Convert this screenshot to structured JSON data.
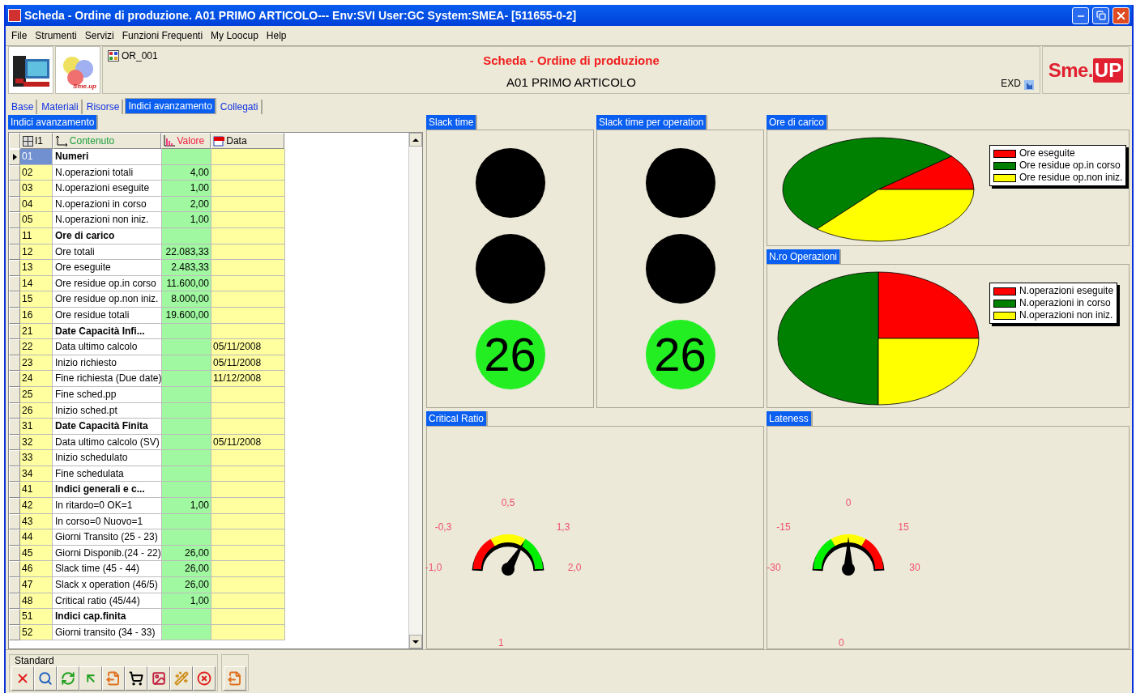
{
  "window": {
    "title": "Scheda - Ordine di produzione. A01 PRIMO ARTICOLO--- Env:SVI User:GC System:SMEA- [511655-0-2]"
  },
  "menu": [
    "File",
    "Strumenti",
    "Servizi",
    "Funzioni Frequenti",
    "My Loocup",
    "Help"
  ],
  "header": {
    "logo_text": "Sme.up",
    "code": "OR_001",
    "title": "Scheda - Ordine di produzione",
    "subtitle": "A01 PRIMO ARTICOLO",
    "exd": "EXD",
    "brand_left": "Sme.",
    "brand_right": "UP"
  },
  "tabs": [
    {
      "label": "Base",
      "selected": false
    },
    {
      "label": "Materiali",
      "selected": false
    },
    {
      "label": "Risorse",
      "selected": false
    },
    {
      "label": "Indici avanzamento",
      "selected": true
    },
    {
      "label": "Collegati",
      "selected": false
    }
  ],
  "table": {
    "title": "Indici avanzamento",
    "columns": [
      "I1",
      "Contenuto",
      "Valore",
      "Data"
    ],
    "rows": [
      {
        "id": "01",
        "content": "Numeri",
        "value": "",
        "date": "",
        "kind": "heading",
        "selected": true
      },
      {
        "id": "02",
        "content": "N.operazioni totali",
        "value": "4,00",
        "date": "",
        "kind": "item",
        "selected": false
      },
      {
        "id": "03",
        "content": "N.operazioni eseguite",
        "value": "1,00",
        "date": "",
        "kind": "item",
        "selected": false
      },
      {
        "id": "04",
        "content": "N.operazioni in corso",
        "value": "2,00",
        "date": "",
        "kind": "item",
        "selected": false
      },
      {
        "id": "05",
        "content": "N.operazioni non iniz.",
        "value": "1,00",
        "date": "",
        "kind": "item",
        "selected": false
      },
      {
        "id": "11",
        "content": "Ore di carico",
        "value": "",
        "date": "",
        "kind": "heading",
        "selected": false
      },
      {
        "id": "12",
        "content": "Ore totali",
        "value": "22.083,33",
        "date": "",
        "kind": "item",
        "selected": false
      },
      {
        "id": "13",
        "content": "Ore eseguite",
        "value": "2.483,33",
        "date": "",
        "kind": "item",
        "selected": false
      },
      {
        "id": "14",
        "content": "Ore residue op.in corso",
        "value": "11.600,00",
        "date": "",
        "kind": "item",
        "selected": false
      },
      {
        "id": "15",
        "content": "Ore residue op.non iniz.",
        "value": "8.000,00",
        "date": "",
        "kind": "item",
        "selected": false
      },
      {
        "id": "16",
        "content": "Ore residue totali",
        "value": "19.600,00",
        "date": "",
        "kind": "item",
        "selected": false
      },
      {
        "id": "21",
        "content": "Date Capacità Infi...",
        "value": "",
        "date": "",
        "kind": "heading",
        "selected": false
      },
      {
        "id": "22",
        "content": "Data ultimo calcolo",
        "value": "",
        "date": "05/11/2008",
        "kind": "item",
        "selected": false
      },
      {
        "id": "23",
        "content": "Inizio richiesto",
        "value": "",
        "date": "05/11/2008",
        "kind": "item",
        "selected": false
      },
      {
        "id": "24",
        "content": "Fine richiesta (Due date)",
        "value": "",
        "date": "11/12/2008",
        "kind": "item",
        "selected": false
      },
      {
        "id": "25",
        "content": "Fine sched.pp",
        "value": "",
        "date": "",
        "kind": "item",
        "selected": false
      },
      {
        "id": "26",
        "content": "Inizio sched.pt",
        "value": "",
        "date": "",
        "kind": "item",
        "selected": false
      },
      {
        "id": "31",
        "content": "Date Capacità Finita",
        "value": "",
        "date": "",
        "kind": "heading",
        "selected": false
      },
      {
        "id": "32",
        "content": "Data ultimo calcolo (SV)",
        "value": "",
        "date": "05/11/2008",
        "kind": "item",
        "selected": false
      },
      {
        "id": "33",
        "content": "Inizio schedulato",
        "value": "",
        "date": "",
        "kind": "item",
        "selected": false
      },
      {
        "id": "34",
        "content": "Fine schedulata",
        "value": "",
        "date": "",
        "kind": "item",
        "selected": false
      },
      {
        "id": "41",
        "content": "Indici generali e c...",
        "value": "",
        "date": "",
        "kind": "heading",
        "selected": false
      },
      {
        "id": "42",
        "content": "In ritardo=0   OK=1",
        "value": "1,00",
        "date": "",
        "kind": "item",
        "selected": false
      },
      {
        "id": "43",
        "content": "In corso=0 Nuovo=1",
        "value": "",
        "date": "",
        "kind": "item",
        "selected": false
      },
      {
        "id": "44",
        "content": "Giorni Transito (25 - 23)",
        "value": "",
        "date": "",
        "kind": "item",
        "selected": false
      },
      {
        "id": "45",
        "content": "Giorni Disponib.(24 - 22)",
        "value": "26,00",
        "date": "",
        "kind": "item",
        "selected": false
      },
      {
        "id": "46",
        "content": "Slack time (45 - 44)",
        "value": "26,00",
        "date": "",
        "kind": "item",
        "selected": false
      },
      {
        "id": "47",
        "content": "Slack x operation (46/5)",
        "value": "26,00",
        "date": "",
        "kind": "item",
        "selected": false
      },
      {
        "id": "48",
        "content": "Critical ratio (45/44)",
        "value": "1,00",
        "date": "",
        "kind": "item",
        "selected": false
      },
      {
        "id": "51",
        "content": "Indici cap.finita",
        "value": "",
        "date": "",
        "kind": "heading",
        "selected": false
      },
      {
        "id": "52",
        "content": "Giorni transito (34 - 33)",
        "value": "",
        "date": "",
        "kind": "item",
        "selected": false
      }
    ]
  },
  "slack_panels": [
    {
      "title": "Slack time",
      "lights": [
        {
          "color": "#000000"
        },
        {
          "color": "#000000"
        },
        {
          "color": "#22ee22",
          "text": "26"
        }
      ]
    },
    {
      "title": "Slack time per operation",
      "lights": [
        {
          "color": "#000000"
        },
        {
          "color": "#000000"
        },
        {
          "color": "#22ee22",
          "text": "26"
        }
      ]
    }
  ],
  "pie_panels": [
    {
      "title": "Ore di carico",
      "legend": [
        {
          "label": "Ore eseguite",
          "color": "#ff0000"
        },
        {
          "label": "Ore residue op.in corso",
          "color": "#008000"
        },
        {
          "label": "Ore residue op.non iniz.",
          "color": "#ffff00"
        }
      ]
    },
    {
      "title": "N.ro Operazioni",
      "legend": [
        {
          "label": "N.operazioni eseguite",
          "color": "#ff0000"
        },
        {
          "label": "N.operazioni in corso",
          "color": "#008000"
        },
        {
          "label": "N.operazioni non iniz.",
          "color": "#ffff00"
        }
      ]
    }
  ],
  "gauges": [
    {
      "title": "Critical Ratio",
      "ticks": [
        "-1,0",
        "-0,3",
        "0,5",
        "1,3",
        "2,0"
      ],
      "reading": "1",
      "bands": [
        {
          "color": "#ff0000"
        },
        {
          "color": "#ffff00"
        },
        {
          "color": "#00ee00"
        }
      ]
    },
    {
      "title": "Lateness",
      "ticks": [
        "-30",
        "-15",
        "0",
        "15",
        "30"
      ],
      "reading": "0",
      "bands": [
        {
          "color": "#00ee00"
        },
        {
          "color": "#ffff00"
        },
        {
          "color": "#ff0000"
        }
      ]
    }
  ],
  "toolbar": {
    "title": "Standard"
  }
}
